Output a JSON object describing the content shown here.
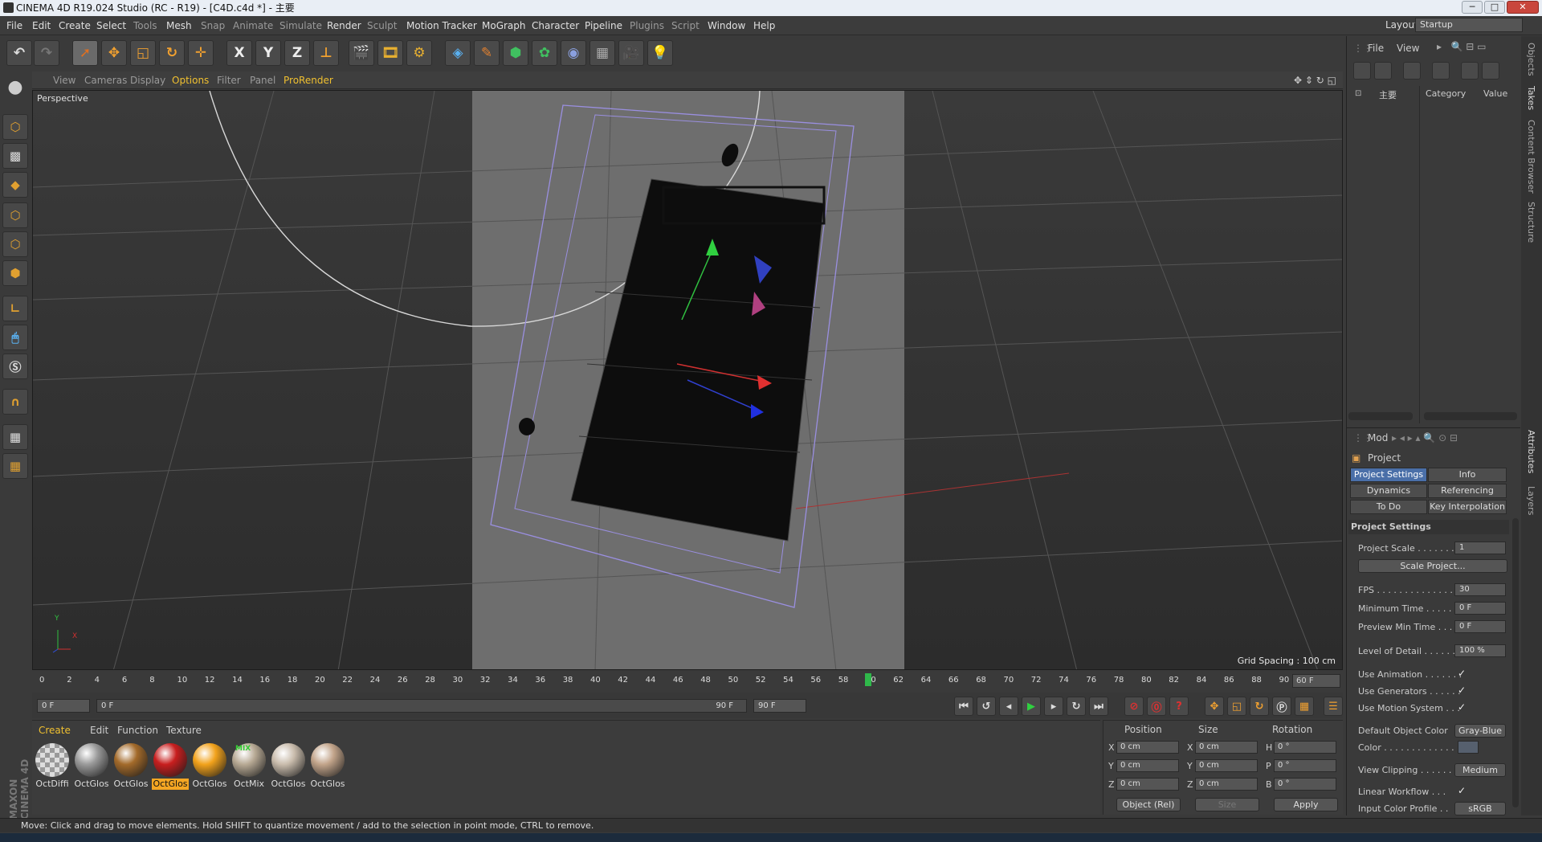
{
  "window": {
    "title": "CINEMA 4D R19.024 Studio (RC - R19) - [C4D.c4d *] - 主要",
    "min": "─",
    "max": "□",
    "close": "✕"
  },
  "menu": {
    "items": [
      "File",
      "Edit",
      "Create",
      "Select",
      "Tools",
      "Mesh",
      "Snap",
      "Animate",
      "Simulate",
      "Render",
      "Sculpt",
      "Motion Tracker",
      "MoGraph",
      "Character",
      "Pipeline",
      "Plugins",
      "Script",
      "Window",
      "Help"
    ],
    "layout_label": "Layout:",
    "layout_value": "Startup"
  },
  "toolbar": {
    "x_label": "X",
    "y_label": "Y",
    "z_label": "Z"
  },
  "viewport": {
    "menu": [
      "View",
      "Cameras",
      "Display",
      "Options",
      "Filter",
      "Panel",
      "ProRender"
    ],
    "label": "Perspective",
    "grid_spacing": "Grid Spacing : 100 cm",
    "axis_x": "X",
    "axis_y": "Y"
  },
  "timeline": {
    "ticks": [
      "0",
      "2",
      "4",
      "6",
      "8",
      "10",
      "12",
      "14",
      "16",
      "18",
      "20",
      "22",
      "24",
      "26",
      "28",
      "30",
      "32",
      "34",
      "36",
      "38",
      "40",
      "42",
      "44",
      "46",
      "48",
      "50",
      "52",
      "54",
      "56",
      "58",
      "60",
      "62",
      "64",
      "66",
      "68",
      "70",
      "72",
      "74",
      "76",
      "78",
      "80",
      "82",
      "84",
      "86",
      "88",
      "90"
    ],
    "current_frame": 60,
    "max_frame": 90,
    "end_field": "60 F"
  },
  "transport": {
    "start": "0 F",
    "slider_left": "0 F",
    "slider_right": "90 F",
    "end": "90 F"
  },
  "materials": {
    "menu": [
      "Create",
      "Edit",
      "Function",
      "Texture"
    ],
    "items": [
      {
        "label": "OctDiffi",
        "color": "#cfcfcf",
        "selected": false
      },
      {
        "label": "OctGlos",
        "color": "#9a9a9a",
        "selected": false
      },
      {
        "label": "OctGlos",
        "color": "#a36a2a",
        "selected": false
      },
      {
        "label": "OctGlos",
        "color": "#c81e1e",
        "selected": true
      },
      {
        "label": "OctGlos",
        "color": "#f2a21b",
        "selected": false
      },
      {
        "label": "OctMix",
        "color": "#b7a994",
        "selected": false,
        "badge": "MIX"
      },
      {
        "label": "OctGlos",
        "color": "#c9bcac",
        "selected": false
      },
      {
        "label": "OctGlos",
        "color": "#c2a48a",
        "selected": false
      }
    ]
  },
  "brand": "MAXON CINEMA 4D",
  "coords": {
    "headers": {
      "position": "Position",
      "size": "Size",
      "rotation": "Rotation"
    },
    "rows": [
      {
        "axis": "X",
        "pos": "0 cm",
        "size_axis": "X",
        "size": "0 cm",
        "rot_axis": "H",
        "rot": "0 °"
      },
      {
        "axis": "Y",
        "pos": "0 cm",
        "size_axis": "Y",
        "size": "0 cm",
        "rot_axis": "P",
        "rot": "0 °"
      },
      {
        "axis": "Z",
        "pos": "0 cm",
        "size_axis": "Z",
        "size": "0 cm",
        "rot_axis": "B",
        "rot": "0 °"
      }
    ],
    "mode": "Object (Rel)",
    "size_mode": "Size",
    "apply": "Apply"
  },
  "status": "Move: Click and drag to move elements. Hold SHIFT to quantize movement / add to the selection in point mode, CTRL to remove.",
  "objects_panel": {
    "menu": [
      "File",
      "View"
    ],
    "take_name": "主要",
    "columns": [
      "Category",
      "Value"
    ]
  },
  "attributes": {
    "mode_label": "Mod",
    "project_label": "Project",
    "tabs": [
      {
        "label": "Project Settings",
        "active": true
      },
      {
        "label": "Info",
        "active": false
      },
      {
        "label": "Dynamics",
        "active": false
      },
      {
        "label": "Referencing",
        "active": false
      },
      {
        "label": "To Do",
        "active": false
      },
      {
        "label": "Key Interpolation",
        "active": false
      }
    ],
    "section_title": "Project Settings",
    "rows": [
      {
        "label": "Project Scale . . . . . . . .",
        "value": "1"
      },
      {
        "label": "FPS . . . . . . . . . . . . . . . .",
        "value": "30"
      },
      {
        "label": "Minimum Time . . . . . . .",
        "value": "0 F"
      },
      {
        "label": "Preview Min Time . . . .",
        "value": "0 F"
      },
      {
        "label": "Level of Detail . . . . . . .",
        "value": "100 %"
      }
    ],
    "scale_button": "Scale Project...",
    "checks": [
      {
        "label": "Use Animation . . . . . . .",
        "mark": "✓"
      },
      {
        "label": "Use Generators . . . . . .",
        "mark": "✓"
      },
      {
        "label": "Use Motion System . . .",
        "mark": "✓"
      }
    ],
    "default_color_label": "Default Object Color",
    "default_color_value": "Gray-Blue",
    "color_label": "Color . . . . . . . . . . . . .",
    "view_clipping_label": "View Clipping . . . . . . .",
    "view_clipping_value": "Medium",
    "linear_workflow_label": "Linear Workflow . . .",
    "linear_workflow_mark": "✓",
    "input_profile_label": "Input Color Profile . .",
    "input_profile_value": "sRGB"
  },
  "side_tabs": [
    "Objects",
    "Takes",
    "Content Browser",
    "Structure",
    "Attributes",
    "Layers"
  ]
}
